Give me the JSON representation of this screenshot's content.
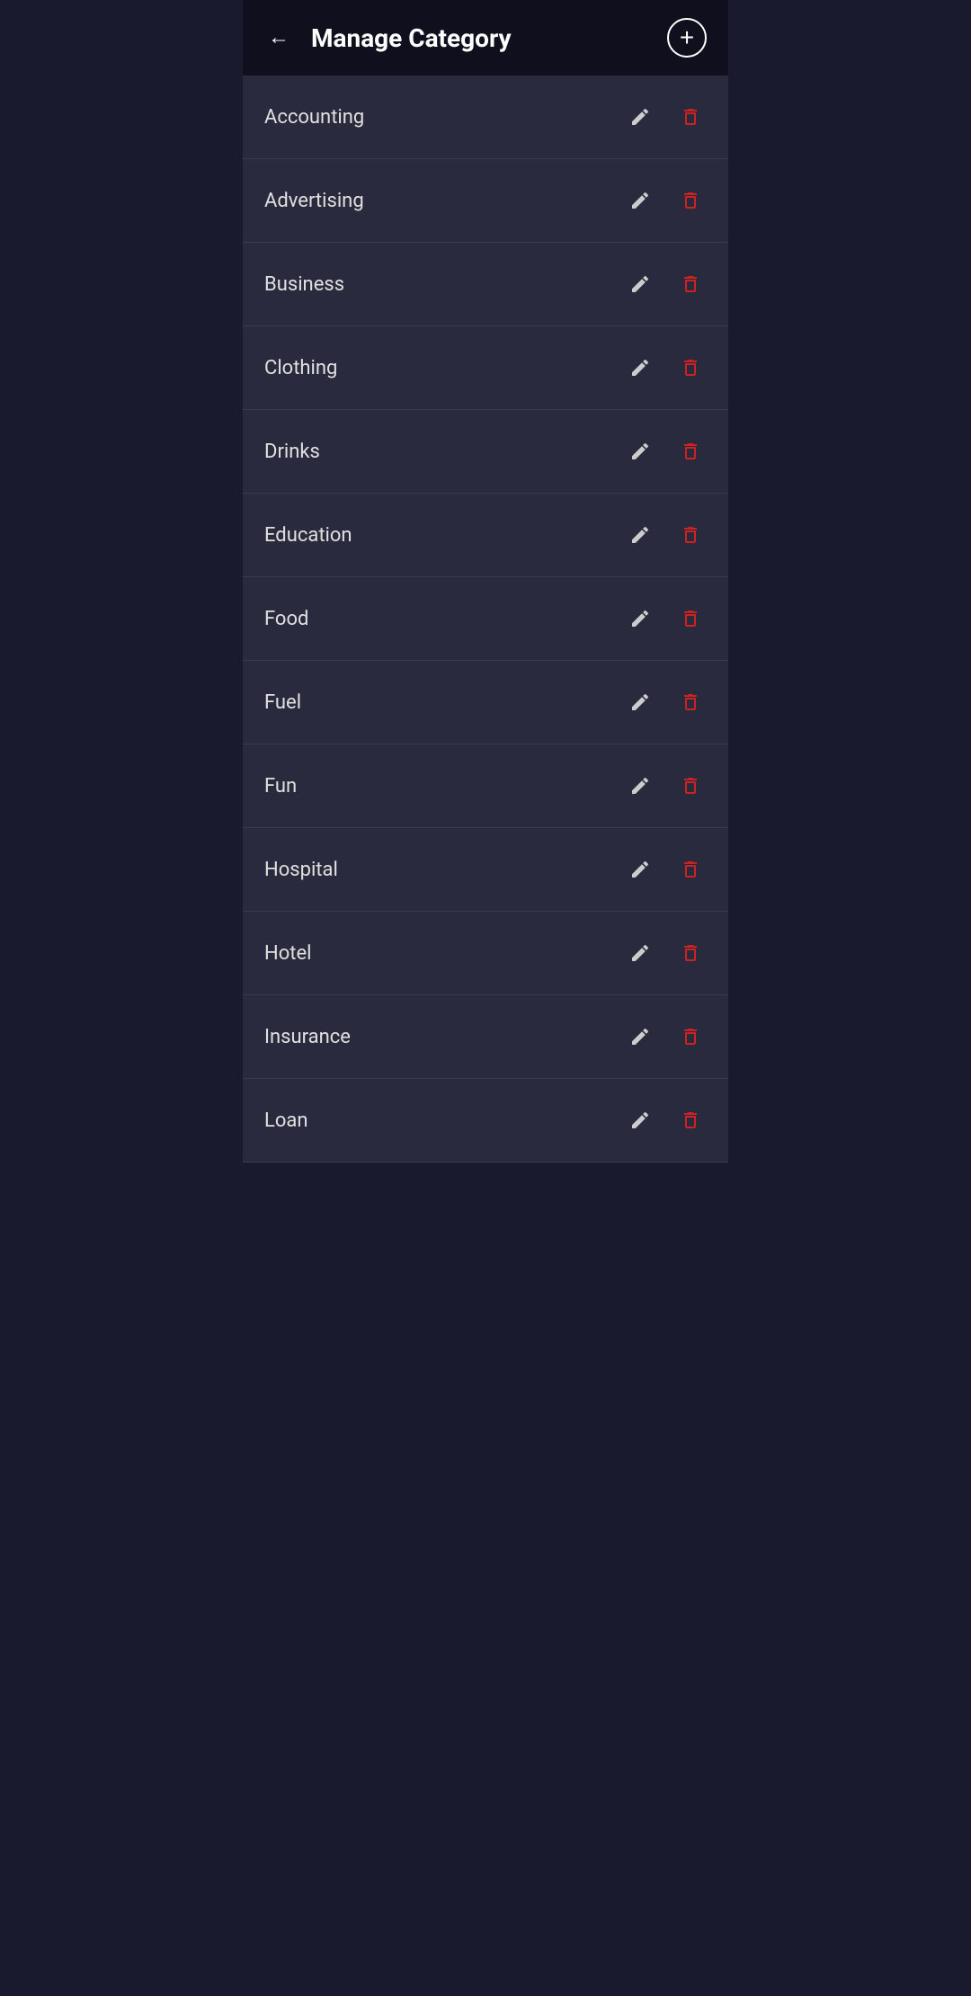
{
  "header": {
    "back_label": "←",
    "title": "Manage Category",
    "add_label": "+"
  },
  "categories": [
    {
      "id": "accounting",
      "name": "Accounting"
    },
    {
      "id": "advertising",
      "name": "Advertising"
    },
    {
      "id": "business",
      "name": "Business"
    },
    {
      "id": "clothing",
      "name": "Clothing"
    },
    {
      "id": "drinks",
      "name": "Drinks"
    },
    {
      "id": "education",
      "name": "Education"
    },
    {
      "id": "food",
      "name": "Food"
    },
    {
      "id": "fuel",
      "name": "Fuel"
    },
    {
      "id": "fun",
      "name": "Fun"
    },
    {
      "id": "hospital",
      "name": "Hospital"
    },
    {
      "id": "hotel",
      "name": "Hotel"
    },
    {
      "id": "insurance",
      "name": "Insurance"
    },
    {
      "id": "loan",
      "name": "Loan"
    }
  ],
  "colors": {
    "header_bg": "#0f0f1e",
    "list_bg": "#2a2a3e",
    "body_bg": "#1a1a2e",
    "delete_color": "#cc2222",
    "edit_color": "#cccccc",
    "text_color": "#e0e0e0",
    "divider_color": "#3a3a4e"
  }
}
